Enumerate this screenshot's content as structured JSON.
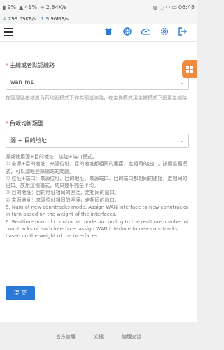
{
  "status": {
    "battery_pct": "9%",
    "signal_pct": "41%",
    "speed_main": "2.84K/s",
    "speed_down": "299.09KB/s",
    "speed_up": "9.96MB/s",
    "time": "06:48"
  },
  "toolbar": {
    "icons": [
      "shirt-icon",
      "globe-icon",
      "cloud-upload-icon",
      "gear-icon",
      "logout-icon"
    ]
  },
  "form": {
    "primary_line_label": "主線或者默認線路",
    "primary_line_value": "wan_m1",
    "primary_line_hint": "在智慧路由或者負荷均衡模式下作為預設線路，在主備模式用主備模式下設置主線路",
    "lb_type_label": "負載均衡類型",
    "lb_type_value": "源 + 目的地址",
    "description": [
      "源或使用源+目的地址，該加+端口模式。",
      "① 來源+目的地址：來源位址、目的地址都相同的連接，走相同的出口。該用這種模式，可以減輕登錄網站的問題。",
      "② 位址+端口：來源位址、目的地址、來源端口、目的端口都相同的連接，走相同的出口。該用這種模式，結果幾乎完全平均。",
      "③ 目的地址：目的地址相同的連接，走相同的出口。",
      "④ 來源地址：來源位址相同的連接，走相同的出口。",
      "5. Num of new conntracks mode. Assign WAN interface to new conntracks in turn based on the weight of the interfaces.",
      "6. Realtime num of conntracks mode. According to the realtime number of conntracks of each interface, assign WAN interface to new conntracks based on the weight of the interfaces."
    ],
    "submit_label": "提 交"
  },
  "footer": {
    "links": [
      "官方論壇",
      "文檔",
      "論壇交流"
    ]
  }
}
